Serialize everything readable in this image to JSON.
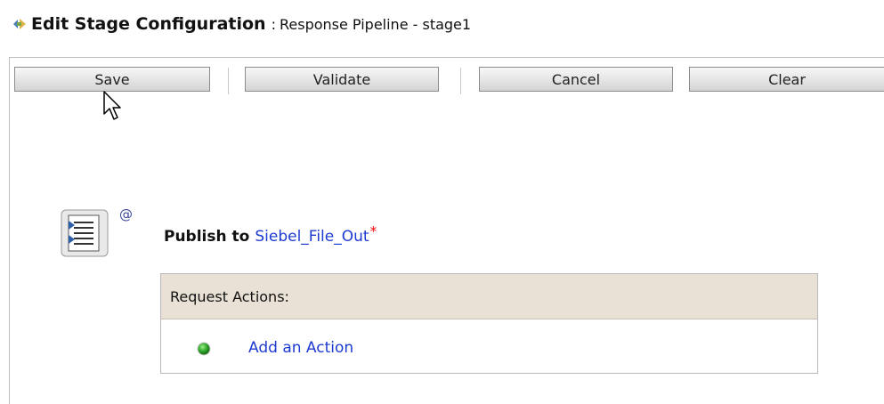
{
  "header": {
    "title": "Edit Stage Configuration",
    "separator": ":",
    "subtitle": "Response Pipeline - stage1",
    "icon": "pipeline-stage-icon"
  },
  "toolbar": {
    "save_label": "Save",
    "validate_label": "Validate",
    "cancel_label": "Cancel",
    "clear_label": "Clear"
  },
  "stage": {
    "icon": "publish-action-icon",
    "at_symbol": "@",
    "publish_label": "Publish to",
    "target": "Siebel_File_Out",
    "required_marker": "*"
  },
  "request_actions": {
    "header": "Request Actions:",
    "add_action_label": "Add an Action",
    "add_icon": "green-dot-icon"
  },
  "colors": {
    "link": "#1d3bd1",
    "required": "#e00000",
    "actions_header_bg": "#e9e1d5"
  }
}
